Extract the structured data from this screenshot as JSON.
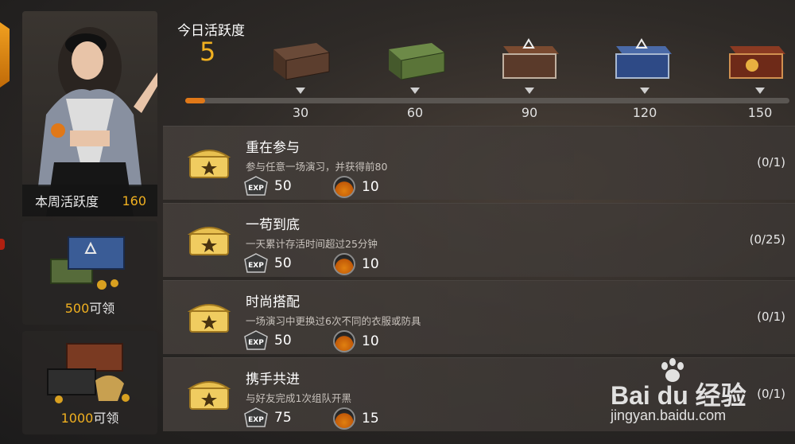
{
  "sidebar": {
    "weekly_label": "本周活跃度",
    "weekly_value": "160",
    "rewards": [
      {
        "amount": "500",
        "suffix": "可领"
      },
      {
        "amount": "1000",
        "suffix": "可领"
      }
    ]
  },
  "progress": {
    "today_label": "今日活跃度",
    "today_value": "5",
    "fill_fraction": 0.033,
    "milestones": [
      "30",
      "60",
      "90",
      "120",
      "150"
    ]
  },
  "tasks": [
    {
      "title": "重在参与",
      "desc": "参与任意一场演习，并获得前80",
      "exp": "50",
      "gold": "10",
      "progress": "(0/1)"
    },
    {
      "title": "一苟到底",
      "desc": "一天累计存活时间超过25分钟",
      "exp": "50",
      "gold": "10",
      "progress": "(0/25)"
    },
    {
      "title": "时尚搭配",
      "desc": "一场演习中更换过6次不同的衣服或防具",
      "exp": "50",
      "gold": "10",
      "progress": "(0/1)"
    },
    {
      "title": "携手共进",
      "desc": "与好友完成1次组队开黑",
      "exp": "75",
      "gold": "15",
      "progress": "(0/1)"
    }
  ],
  "watermark": {
    "main": "Bai du 经验",
    "sub": "jingyan.baidu.com"
  },
  "colors": {
    "accent": "#f0b020",
    "progress_fill": "#e07818"
  },
  "icons": {
    "task": "treasure-chest-icon",
    "exp": "exp-badge-icon",
    "gold": "gold-coin-icon"
  }
}
